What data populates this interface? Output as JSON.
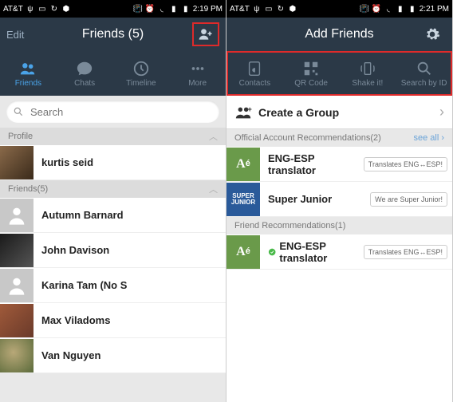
{
  "left": {
    "statusbar": {
      "carrier": "AT&T",
      "time": "2:19 PM"
    },
    "nav": {
      "edit": "Edit",
      "title": "Friends (5)"
    },
    "tabs": [
      "Friends",
      "Chats",
      "Timeline",
      "More"
    ],
    "search_placeholder": "Search",
    "profile_hdr": "Profile",
    "profile": {
      "name": "kurtis seid"
    },
    "friends_hdr": "Friends(5)",
    "friends": [
      {
        "name": "Autumn Barnard"
      },
      {
        "name": "John Davison"
      },
      {
        "name": "Karina Tam (No S"
      },
      {
        "name": "Max Viladoms"
      },
      {
        "name": "Van Nguyen"
      }
    ]
  },
  "right": {
    "statusbar": {
      "carrier": "AT&T",
      "time": "2:21 PM"
    },
    "nav": {
      "title": "Add Friends"
    },
    "methods": [
      "Contacts",
      "QR Code",
      "Shake it!",
      "Search by ID"
    ],
    "create_group": "Create a Group",
    "official_hdr": "Official Account Recommendations(2)",
    "see_all": "see all",
    "official": [
      {
        "name": "ENG-ESP translator",
        "bubble": "Translates ENG↔ESP!",
        "avatar": "Aé"
      },
      {
        "name": "Super Junior",
        "bubble": "We are Super Junior!",
        "avatar": "SUPER JUNIOR"
      }
    ],
    "friend_rec_hdr": "Friend Recommendations(1)",
    "friend_recs": [
      {
        "name": "ENG-ESP translator",
        "bubble": "Translates ENG↔ESP!",
        "avatar": "Aé",
        "verified": true
      }
    ]
  }
}
